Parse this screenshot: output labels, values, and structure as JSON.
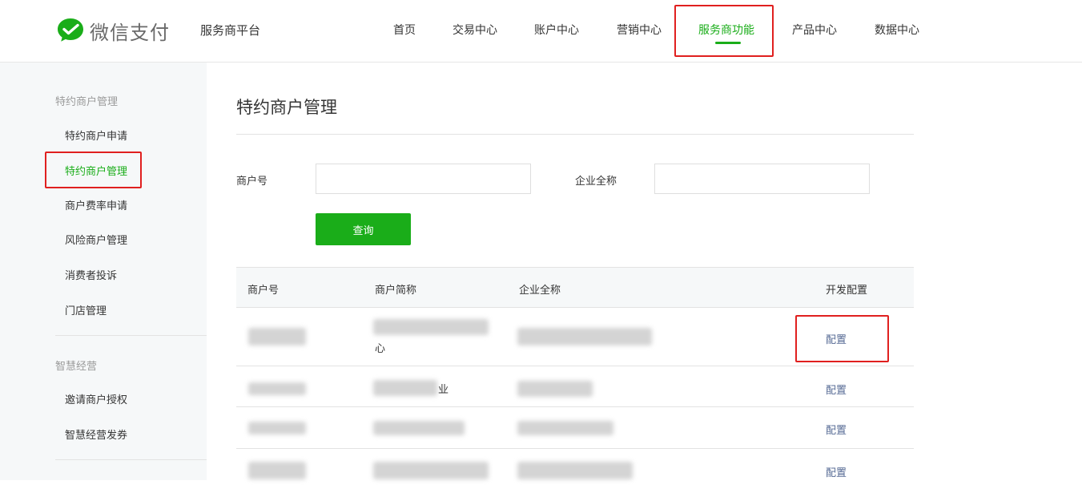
{
  "header": {
    "brand": "微信支付",
    "platform": "服务商平台",
    "nav": [
      "首页",
      "交易中心",
      "账户中心",
      "营销中心",
      "服务商功能",
      "产品中心",
      "数据中心"
    ],
    "active_nav": "服务商功能"
  },
  "sidebar": {
    "groups": [
      {
        "title": "特约商户管理",
        "items": [
          "特约商户申请",
          "特约商户管理",
          "商户费率申请",
          "风险商户管理",
          "消费者投诉",
          "门店管理"
        ]
      },
      {
        "title": "智慧经营",
        "items": [
          "邀请商户授权",
          "智慧经营发券"
        ]
      }
    ],
    "active_item": "特约商户管理"
  },
  "main": {
    "title": "特约商户管理",
    "form": {
      "merchant_no_label": "商户号",
      "merchant_no_value": "",
      "company_name_label": "企业全称",
      "company_name_value": "",
      "query_button": "查询"
    },
    "table": {
      "columns": [
        "商户号",
        "商户简称",
        "企业全称",
        "开发配置"
      ],
      "rows": [
        {
          "short_name_fragment": "心",
          "action": "配置"
        },
        {
          "short_name_fragment": "业",
          "action": "配置"
        },
        {
          "short_name_fragment": "",
          "action": "配置"
        },
        {
          "short_name_fragment": "",
          "action": "配置"
        }
      ]
    }
  },
  "colors": {
    "accent": "#1aad19",
    "link": "#576b95",
    "highlight": "#e0201f",
    "sidebar_bg": "#f6f8f9"
  },
  "icons": {
    "logo": "wechat-pay-logo-icon"
  }
}
